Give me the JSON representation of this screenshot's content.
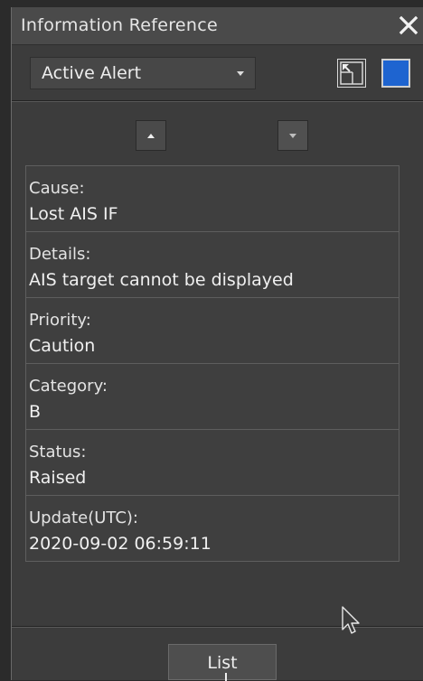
{
  "window": {
    "title": "Information Reference",
    "close_icon": "close-icon"
  },
  "toolbar": {
    "dropdown_value": "Active Alert",
    "restore_icon": "window-restore-icon",
    "square_icon": "blue-square-icon",
    "accent_color": "#1e64d0"
  },
  "nav": {
    "up_icon": "arrow-up-icon",
    "down_icon": "arrow-down-icon"
  },
  "details": [
    {
      "label": "Cause:",
      "value": "Lost AIS IF"
    },
    {
      "label": "Details:",
      "value": "AIS target cannot be displayed"
    },
    {
      "label": "Priority:",
      "value": "Caution"
    },
    {
      "label": "Category:",
      "value": "B"
    },
    {
      "label": "Status:",
      "value": "Raised"
    },
    {
      "label": "Update(UTC):",
      "value": "2020-09-02 06:59:11"
    }
  ],
  "footer": {
    "list_button": "List"
  }
}
